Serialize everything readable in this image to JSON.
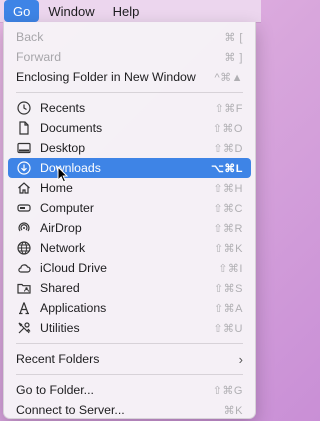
{
  "menubar": {
    "items": [
      "Go",
      "Window",
      "Help"
    ]
  },
  "menu": {
    "group1": [
      {
        "label": "Back",
        "shortcut": "⌘ ["
      },
      {
        "label": "Forward",
        "shortcut": "⌘ ]"
      },
      {
        "label": "Enclosing Folder in New Window",
        "shortcut": "^⌘▲"
      }
    ],
    "group2": [
      {
        "label": "Recents",
        "shortcut": "⇧⌘F",
        "icon": "clock-icon"
      },
      {
        "label": "Documents",
        "shortcut": "⇧⌘O",
        "icon": "document-icon"
      },
      {
        "label": "Desktop",
        "shortcut": "⇧⌘D",
        "icon": "desktop-icon"
      },
      {
        "label": "Downloads",
        "shortcut": "⌥⌘L",
        "icon": "download-icon"
      },
      {
        "label": "Home",
        "shortcut": "⇧⌘H",
        "icon": "home-icon"
      },
      {
        "label": "Computer",
        "shortcut": "⇧⌘C",
        "icon": "computer-icon"
      },
      {
        "label": "AirDrop",
        "shortcut": "⇧⌘R",
        "icon": "airdrop-icon"
      },
      {
        "label": "Network",
        "shortcut": "⇧⌘K",
        "icon": "network-icon"
      },
      {
        "label": "iCloud Drive",
        "shortcut": "⇧⌘I",
        "icon": "cloud-icon"
      },
      {
        "label": "Shared",
        "shortcut": "⇧⌘S",
        "icon": "shared-folder-icon"
      },
      {
        "label": "Applications",
        "shortcut": "⇧⌘A",
        "icon": "applications-icon"
      },
      {
        "label": "Utilities",
        "shortcut": "⇧⌘U",
        "icon": "utilities-icon"
      }
    ],
    "group3": [
      {
        "label": "Recent Folders",
        "submenu_indicator": "›"
      }
    ],
    "group4": [
      {
        "label": "Go to Folder...",
        "shortcut": "⇧⌘G"
      },
      {
        "label": "Connect to Server...",
        "shortcut": "⌘K"
      }
    ]
  },
  "colors": {
    "highlight": "#3e84e6",
    "disabled_text": "#a7a6aa",
    "shortcut_text": "#b0afb3"
  }
}
